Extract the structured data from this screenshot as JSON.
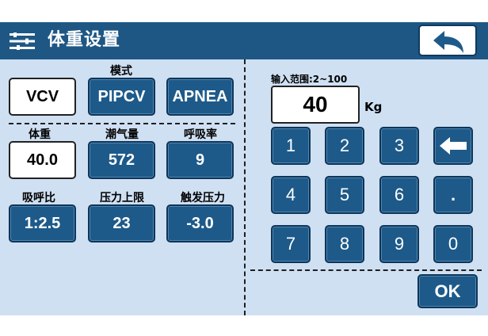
{
  "header": {
    "title": "体重设置",
    "menu_icon": "settings-sliders-icon",
    "back_icon": "back-arrow-icon"
  },
  "mode": {
    "label": "模式",
    "options": [
      "VCV",
      "PIPCV",
      "APNEA"
    ],
    "selected": "VCV"
  },
  "params": [
    {
      "label": "体重",
      "value": "40.0",
      "selected": true
    },
    {
      "label": "潮气量",
      "value": "572"
    },
    {
      "label": "呼吸率",
      "value": "9"
    },
    {
      "label": "吸呼比",
      "value": "1:2.5"
    },
    {
      "label": "压力上限",
      "value": "23"
    },
    {
      "label": "触发压力",
      "value": "-3.0"
    }
  ],
  "keypad": {
    "range_label": "输入范围:2~100",
    "display_value": "40",
    "unit": "Kg",
    "keys": [
      "1",
      "2",
      "3",
      "backspace",
      "4",
      "5",
      "6",
      ".",
      "7",
      "8",
      "9",
      "0"
    ],
    "ok_label": "OK"
  },
  "colors": {
    "title_bar": "#1e5784",
    "background": "#cfe0f3",
    "button": "#1d5a8a",
    "selected_button": "#ffffff"
  }
}
